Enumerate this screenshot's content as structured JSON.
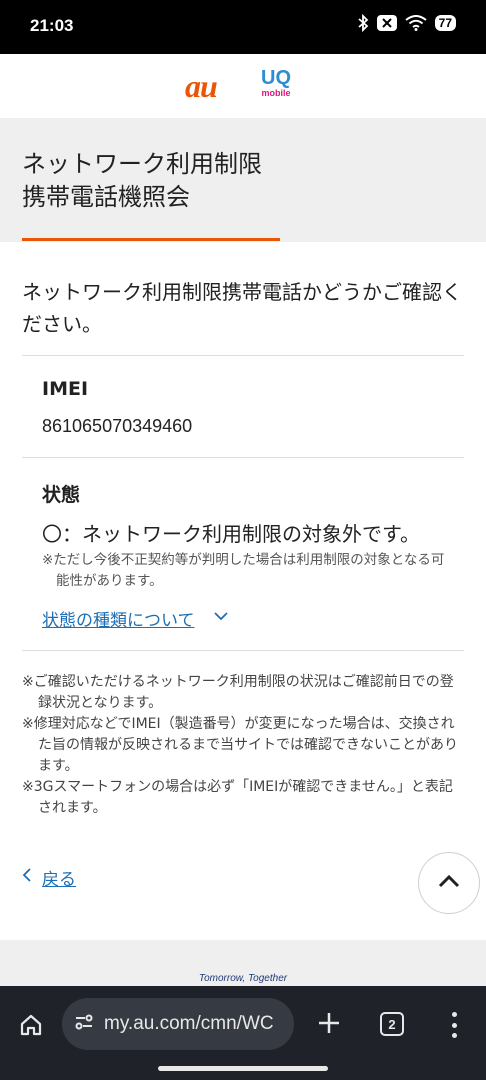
{
  "status_bar": {
    "time": "21:03",
    "battery": "77",
    "icons": [
      "bluetooth-icon",
      "notification-x-icon",
      "wifi-icon",
      "battery-icon"
    ]
  },
  "brand": {
    "au_logo": "au",
    "uq_logo": "UQ",
    "uq_sub": "mobile",
    "au_color": "#eb5505",
    "uq_color": "#2d8fd0",
    "mobile_color": "#d6197c"
  },
  "page": {
    "title_line1": "ネットワーク利用制限",
    "title_line2": "携帯電話機照会",
    "accent_color": "#eb5505",
    "intro": "ネットワーク利用制限携帯電話かどうかご確認ください。"
  },
  "result": {
    "imei_label": "IMEI",
    "imei_value": "861065070349460",
    "status_label": "状態",
    "status_text": "〇：ネットワーク利用制限の対象外です。",
    "status_note": "※ただし今後不正契約等が判明した場合は利用制限の対象となる可能性があります。",
    "status_types_link": "状態の種類について",
    "link_color": "#1c6fb5"
  },
  "notes": [
    "※ご確認いただけるネットワーク利用制限の状況はご確認前日での登録状況となります。",
    "※修理対応などでIMEI（製造番号）が変更になった場合は、交換された旨の情報が反映されるまで当サイトでは確認できないことがあります。",
    "※3Gスマートフォンの場合は必ず「IMEIが確認できません。」と表記されます。"
  ],
  "navigation": {
    "back_label": "戻る"
  },
  "footer": {
    "tagline": "Tomorrow, Together"
  },
  "browser": {
    "url": "my.au.com/cmn/WC",
    "tab_count": "2"
  }
}
